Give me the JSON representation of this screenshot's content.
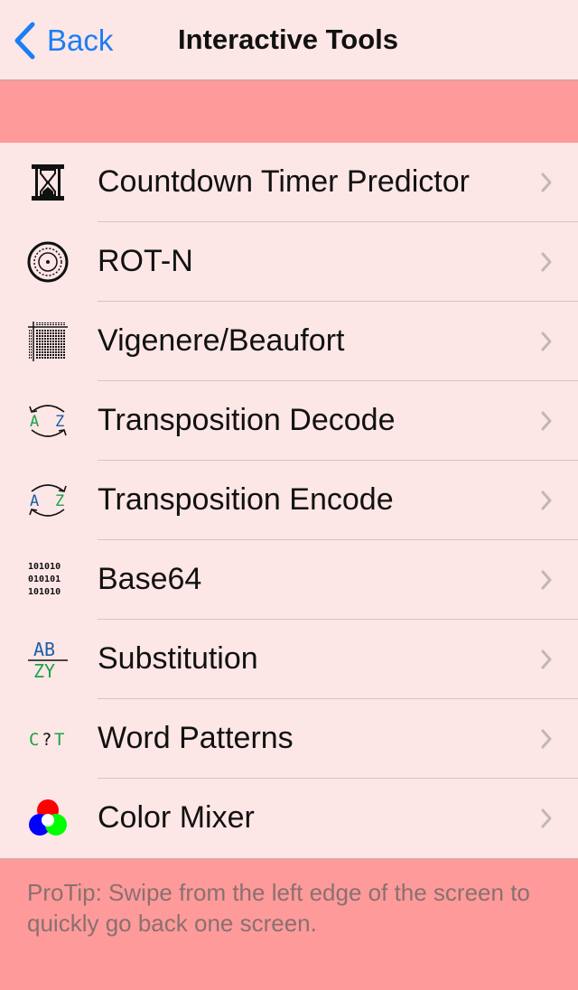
{
  "nav": {
    "back_label": "Back",
    "title": "Interactive Tools"
  },
  "items": [
    {
      "label": "Countdown Timer Predictor",
      "icon": "hourglass-icon"
    },
    {
      "label": "ROT-N",
      "icon": "rotor-dial-icon"
    },
    {
      "label": "Vigenere/Beaufort",
      "icon": "grid-table-icon"
    },
    {
      "label": "Transposition Decode",
      "icon": "swap-arrows-icon",
      "icon_text": [
        "A",
        "Z"
      ]
    },
    {
      "label": "Transposition Encode",
      "icon": "swap-arrows-icon",
      "icon_text": [
        "A",
        "Z"
      ]
    },
    {
      "label": "Base64",
      "icon": "binary-icon",
      "icon_text": [
        "101010",
        "010101",
        "101010"
      ]
    },
    {
      "label": "Substitution",
      "icon": "substitution-icon",
      "icon_text": [
        "AB",
        "ZY"
      ]
    },
    {
      "label": "Word Patterns",
      "icon": "word-pattern-icon",
      "icon_text": [
        "C",
        "?",
        "T"
      ]
    },
    {
      "label": "Color Mixer",
      "icon": "color-circles-icon"
    }
  ],
  "footer": {
    "tip": "ProTip: Swipe from the left edge of the screen to quickly go back one screen."
  },
  "colors": {
    "accent": "#1a7ef5",
    "band": "#fe9a9a",
    "background": "#fde6e6",
    "green": "#1aa34a",
    "blue": "#1a5ea8"
  }
}
